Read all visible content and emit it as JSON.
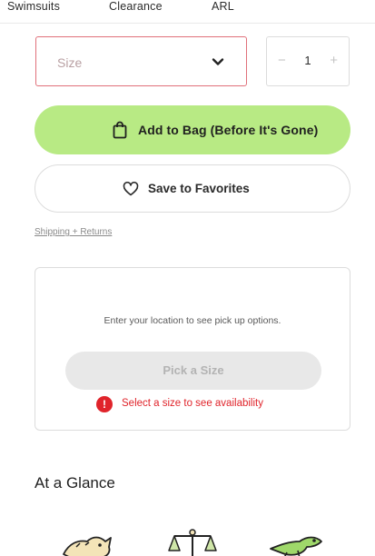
{
  "nav": {
    "items": [
      "Swimsuits",
      "Clearance",
      "ARL"
    ]
  },
  "size_select": {
    "value": "Size",
    "icon": "chevron-down-icon"
  },
  "quantity": {
    "minus": "−",
    "value": "1",
    "plus": "+"
  },
  "add_to_bag": {
    "label": "Add to Bag (Before It's Gone)",
    "icon": "shopping-bag-icon",
    "color": "#b8ea84"
  },
  "save_favorites": {
    "label": "Save to Favorites",
    "icon": "heart-icon"
  },
  "shipping_link": "Shipping + Returns",
  "pickup": {
    "prompt": "Enter your location to see pick up options.",
    "button_label": "Pick a Size",
    "error_symbol": "!",
    "error_text": "Select a size to see availability",
    "error_color": "#e0242b"
  },
  "at_a_glance": {
    "title": "At a Glance",
    "icons": [
      "cat-icon",
      "scales-icon",
      "lizard-icon"
    ]
  }
}
